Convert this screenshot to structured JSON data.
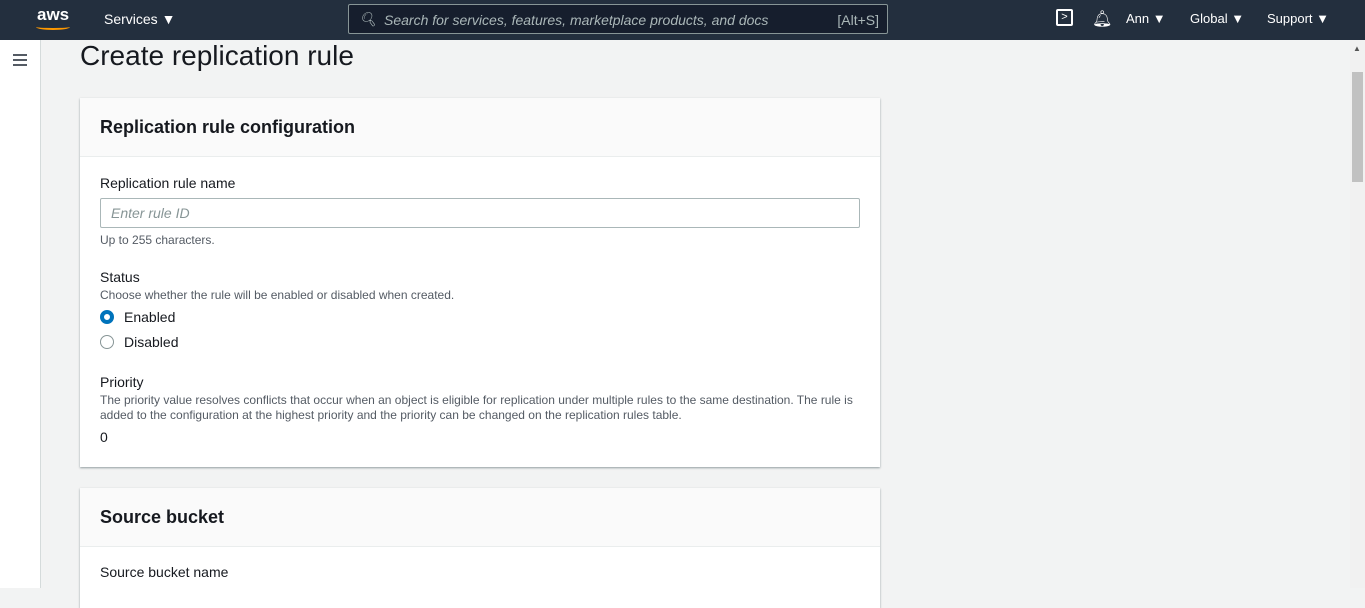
{
  "nav": {
    "logo": "aws",
    "services": "Services",
    "search_placeholder": "Search for services, features, marketplace products, and docs",
    "search_shortcut": "[Alt+S]",
    "user": "Ann",
    "region": "Global",
    "support": "Support"
  },
  "page": {
    "title": "Create replication rule"
  },
  "config": {
    "title": "Replication rule configuration",
    "name_label": "Replication rule name",
    "name_placeholder": "Enter rule ID",
    "name_hint": "Up to 255 characters.",
    "status_label": "Status",
    "status_desc": "Choose whether the rule will be enabled or disabled when created.",
    "enabled": "Enabled",
    "disabled": "Disabled",
    "priority_label": "Priority",
    "priority_desc": "The priority value resolves conflicts that occur when an object is eligible for replication under multiple rules to the same destination. The rule is added to the configuration at the highest priority and the priority can be changed on the replication rules table.",
    "priority_value": "0"
  },
  "source": {
    "title": "Source bucket",
    "name_label": "Source bucket name"
  }
}
